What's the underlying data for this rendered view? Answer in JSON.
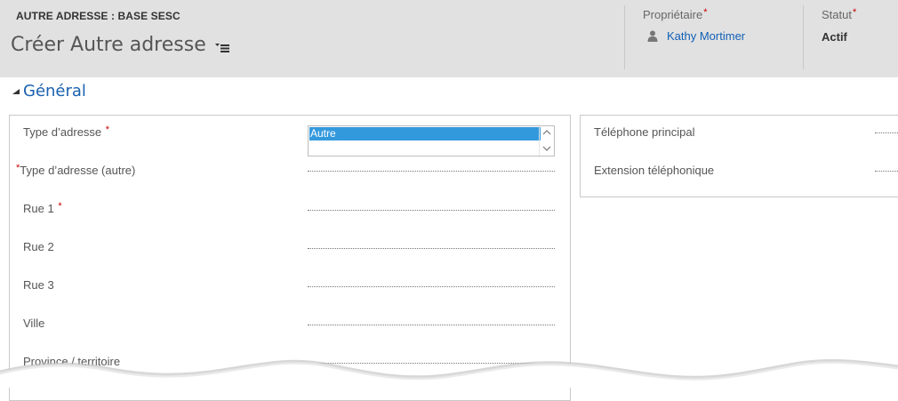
{
  "header": {
    "entity": "AUTRE ADRESSE : BASE SESC",
    "title": "Créer Autre adresse",
    "owner_label": "Propriétaire",
    "owner_value": "Kathy Mortimer",
    "status_label": "Statut",
    "status_value": "Actif",
    "required_mark": "*"
  },
  "section": {
    "title": "Général"
  },
  "left_fields": [
    {
      "label": "Type d’adresse",
      "required": "*"
    },
    {
      "label": "Type d’adresse (autre)",
      "required": "*"
    },
    {
      "label": "Rue 1",
      "required": "*"
    },
    {
      "label": "Rue 2"
    },
    {
      "label": "Rue 3"
    },
    {
      "label": "Ville"
    },
    {
      "label": "Province / territoire"
    }
  ],
  "address_type_select": {
    "selected": "Autre"
  },
  "right_fields": [
    {
      "label": "Téléphone principal"
    },
    {
      "label": "Extension téléphonique"
    }
  ],
  "colors": {
    "header_bg": "#e1e1e1",
    "link": "#1160b7",
    "section_title": "#1a61b0",
    "selection": "#3399dd",
    "required": "#cc0000"
  },
  "icons": [
    "menu-list-icon",
    "person-icon",
    "collapse-caret-icon",
    "scroll-up-icon",
    "scroll-down-icon"
  ]
}
